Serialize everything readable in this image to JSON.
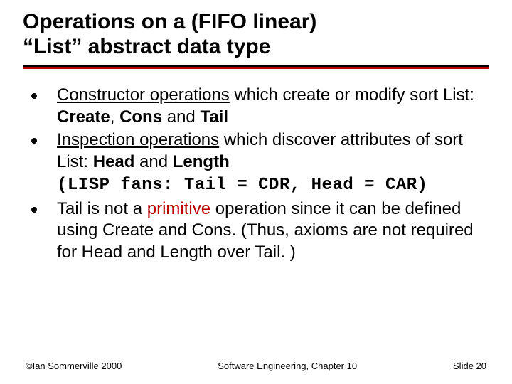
{
  "title_line1": "Operations on a (FIFO linear)",
  "title_line2": "“List” abstract data type",
  "bullets": {
    "b1": {
      "lead_u": "Constructor operations",
      "rest1": " which create or modify sort List:  ",
      "kw1": "Create",
      "sep1": ", ",
      "kw2": "Cons",
      "sep2": " and ",
      "kw3": "Tail"
    },
    "b2": {
      "lead_u": "Inspection operations",
      "rest1": " which discover attributes of sort List:  ",
      "kw1": "Head",
      "sep1": " and ",
      "kw2": "Length",
      "mono": "(LISP fans: Tail = CDR, Head = CAR)"
    },
    "b3": {
      "pre": "Tail is not a ",
      "prim": "primitive",
      "post": " operation since it can be defined using Create and Cons. (Thus, axioms are not required for Head and Length over Tail. )"
    }
  },
  "footer": {
    "left": "©Ian Sommerville 2000",
    "center": "Software Engineering, Chapter 10",
    "right": "Slide  20"
  }
}
